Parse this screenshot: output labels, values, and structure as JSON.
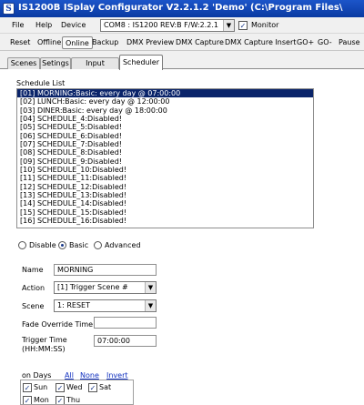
{
  "window": {
    "title": "IS1200B ISplay Configurator V2.2.1.2 'Demo' (C:\\Program Files\\"
  },
  "menu": {
    "file": "File",
    "help": "Help",
    "device": "Device",
    "device_combo": "COM8 : IS1200 REV:B F/W:2.2.1",
    "monitor_label": "Monitor",
    "monitor_checked": "✓"
  },
  "toolbar": {
    "reset": "Reset",
    "offline": "Offline",
    "online": "Online",
    "backup": "Backup",
    "dmx_preview": "DMX Preview",
    "dmx_capture": "DMX Capture",
    "dmx_capture_insert": "DMX Capture Insert",
    "go_plus": "GO+",
    "go_minus": "GO-",
    "pause": "Pause"
  },
  "tabs": {
    "scenes": "Scenes",
    "settings": "Setings",
    "input_triggers": "Input Triggers",
    "scheduler": "Scheduler"
  },
  "scheduler": {
    "list_title": "Schedule List",
    "items": [
      "[01] MORNING:Basic: every day @ 07:00:00",
      "[02] LUNCH:Basic: every day @ 12:00:00",
      "[03] DINER:Basic: every day @ 18:00:00",
      "[04] SCHEDULE_4:Disabled!",
      "[05] SCHEDULE_5:Disabled!",
      "[06] SCHEDULE_6:Disabled!",
      "[07] SCHEDULE_7:Disabled!",
      "[08] SCHEDULE_8:Disabled!",
      "[09] SCHEDULE_9:Disabled!",
      "[10] SCHEDULE_10:Disabled!",
      "[11] SCHEDULE_11:Disabled!",
      "[12] SCHEDULE_12:Disabled!",
      "[13] SCHEDULE_13:Disabled!",
      "[14] SCHEDULE_14:Disabled!",
      "[15] SCHEDULE_15:Disabled!",
      "[16] SCHEDULE_16:Disabled!"
    ],
    "mode": {
      "disable": "Disable",
      "basic": "Basic",
      "advanced": "Advanced"
    },
    "name_label": "Name",
    "name_value": "MORNING",
    "action_label": "Action",
    "action_value": "[1] Trigger Scene #",
    "scene_label": "Scene",
    "scene_value": "1: RESET",
    "fade_label": "Fade Override Time",
    "fade_value": "",
    "trigger_label_1": "Trigger Time",
    "trigger_label_2": "(HH:MM:SS)",
    "trigger_value": "07:00:00",
    "days_label": "on Days",
    "all": "All",
    "none": "None",
    "invert": "Invert",
    "days": {
      "sun": "Sun",
      "wed": "Wed",
      "sat": "Sat",
      "mon": "Mon",
      "thu": "Thu"
    },
    "check_mark": "✓"
  }
}
